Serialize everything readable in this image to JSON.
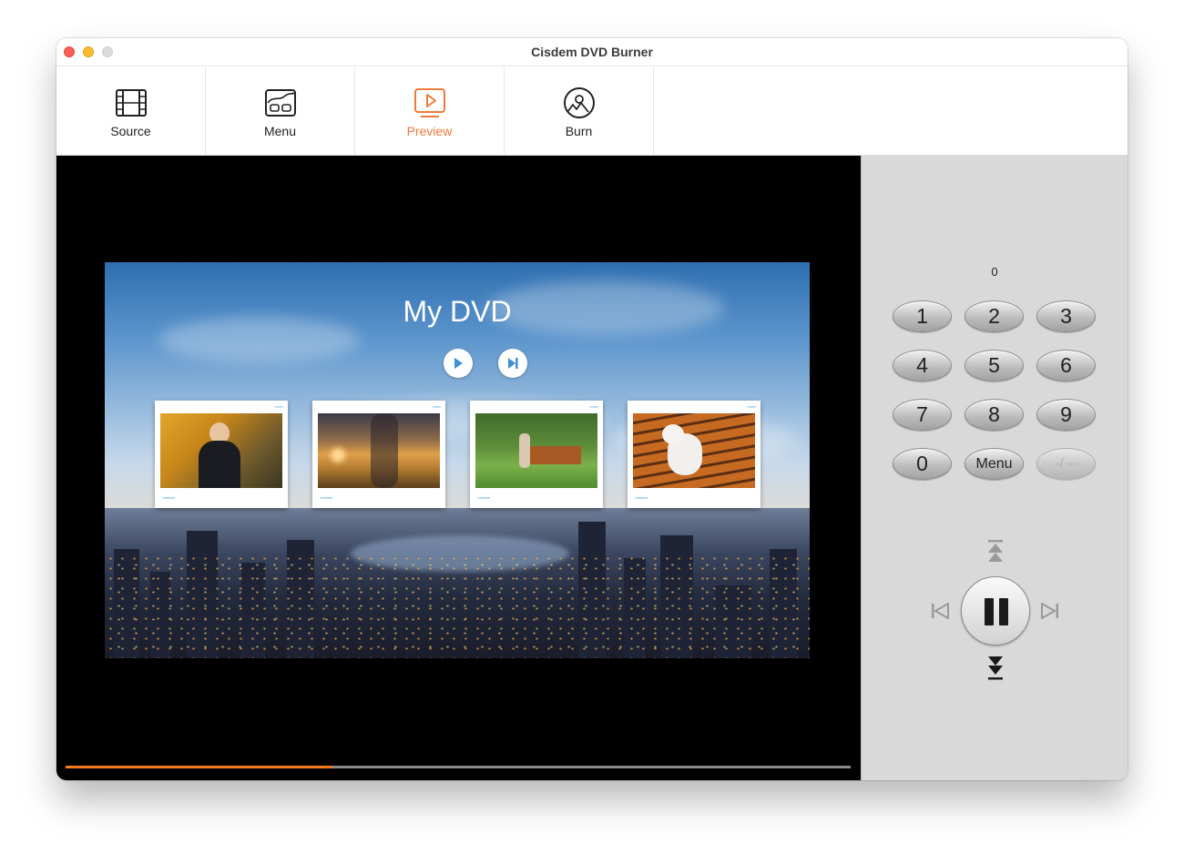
{
  "window": {
    "title": "Cisdem DVD Burner"
  },
  "toolbar": {
    "items": [
      {
        "label": "Source",
        "icon": "film-icon"
      },
      {
        "label": "Menu",
        "icon": "menu-layout-icon"
      },
      {
        "label": "Preview",
        "icon": "preview-play-icon",
        "active": true
      },
      {
        "label": "Burn",
        "icon": "disc-burn-icon"
      }
    ]
  },
  "preview": {
    "dvd_title": "My DVD",
    "playback_progress": 0.34,
    "thumbnails": [
      {
        "icon": "person-autumn-thumbnail"
      },
      {
        "icon": "sunset-field-thumbnail"
      },
      {
        "icon": "park-bench-thumbnail"
      },
      {
        "icon": "dog-bench-thumbnail"
      }
    ]
  },
  "remote": {
    "counter": "0",
    "keys": [
      "1",
      "2",
      "3",
      "4",
      "5",
      "6",
      "7",
      "8",
      "9",
      "0",
      "Menu",
      "-/ --"
    ]
  },
  "colors": {
    "accent": "#ee7a3b",
    "progress": "#ff7a1a",
    "remote_bg": "#d9d9d9"
  }
}
